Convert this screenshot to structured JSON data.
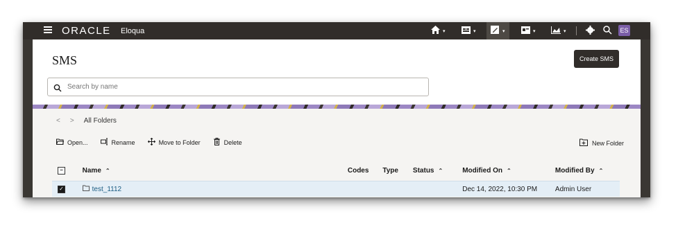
{
  "topbar": {
    "brand": "ORACLE",
    "product": "Eloqua",
    "user_initials": "ES"
  },
  "page": {
    "title": "SMS",
    "create_label": "Create SMS"
  },
  "search": {
    "placeholder": "Search by name",
    "value": ""
  },
  "browser": {
    "breadcrumb": "All Folders",
    "actions": {
      "open": "Open...",
      "rename": "Rename",
      "move": "Move to Folder",
      "delete": "Delete",
      "new_folder": "New Folder"
    }
  },
  "table": {
    "headers": {
      "name": "Name",
      "codes": "Codes",
      "type": "Type",
      "status": "Status",
      "modified_on": "Modified On",
      "modified_by": "Modified By"
    },
    "rows": [
      {
        "name": "test_1112",
        "codes": "",
        "type": "",
        "status": "",
        "modified_on": "Dec 14, 2022, 10:30 PM",
        "modified_by": "Admin User",
        "checked": true
      }
    ]
  }
}
